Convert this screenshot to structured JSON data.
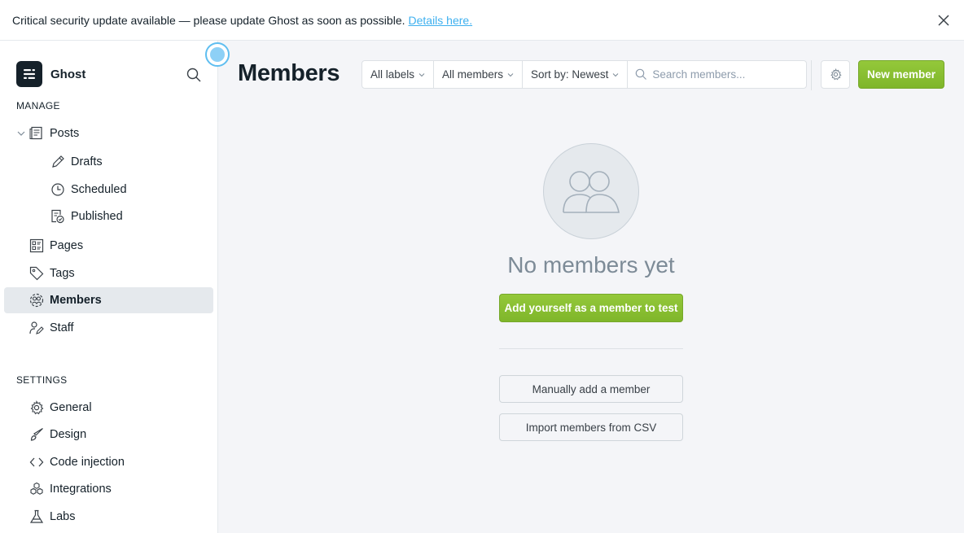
{
  "banner": {
    "message": "Critical security update available — please update Ghost as soon as possible.",
    "link_text": "Details here."
  },
  "brand": {
    "name": "Ghost"
  },
  "sidebar": {
    "manage_label": "MANAGE",
    "settings_label": "SETTINGS",
    "manage_items": [
      {
        "label": "Posts",
        "icon": "posts-icon"
      },
      {
        "label": "Drafts",
        "icon": "pencil-icon"
      },
      {
        "label": "Scheduled",
        "icon": "clock-icon"
      },
      {
        "label": "Published",
        "icon": "published-icon"
      },
      {
        "label": "Pages",
        "icon": "pages-icon"
      },
      {
        "label": "Tags",
        "icon": "tag-icon"
      },
      {
        "label": "Members",
        "icon": "members-icon",
        "active": true
      },
      {
        "label": "Staff",
        "icon": "staff-icon"
      }
    ],
    "settings_items": [
      {
        "label": "General",
        "icon": "gear-icon"
      },
      {
        "label": "Design",
        "icon": "brush-icon"
      },
      {
        "label": "Code injection",
        "icon": "code-icon"
      },
      {
        "label": "Integrations",
        "icon": "integrations-icon"
      },
      {
        "label": "Labs",
        "icon": "flask-icon"
      }
    ]
  },
  "main": {
    "title": "Members",
    "filters": {
      "labels": "All labels",
      "members": "All members",
      "sort": "Sort by: Newest"
    },
    "search_placeholder": "Search members...",
    "new_member_label": "New member",
    "empty": {
      "title": "No members yet",
      "add_yourself": "Add yourself as a member to test",
      "manual_add": "Manually add a member",
      "import_csv": "Import members from CSV"
    }
  },
  "colors": {
    "accent_green": "#8ec42d",
    "link_blue": "#3eb0ef",
    "active_bg": "#e5e9ed"
  }
}
